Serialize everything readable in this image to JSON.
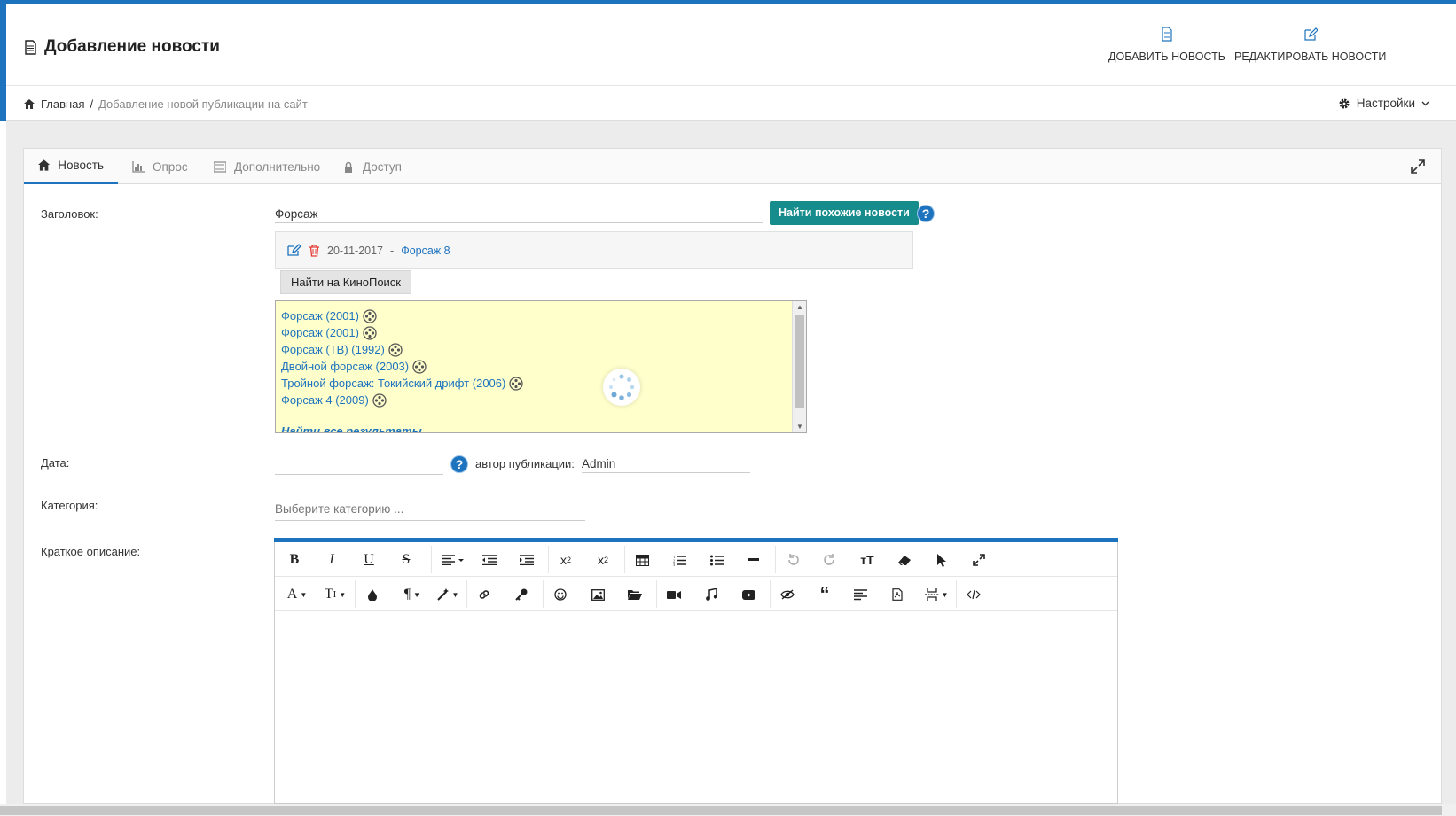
{
  "header": {
    "title": "Добавление новости",
    "actions": [
      {
        "label": "ДОБАВИТЬ НОВОСТЬ",
        "icon": "document-icon"
      },
      {
        "label": "РЕДАКТИРОВАТЬ НОВОСТИ",
        "icon": "edit-icon"
      }
    ]
  },
  "breadcrumb": {
    "home": "Главная",
    "separator": "/",
    "current": "Добавление новой публикации на сайт"
  },
  "settings": {
    "label": "Настройки"
  },
  "tabs": [
    {
      "label": "Новость",
      "icon": "home-icon",
      "active": true
    },
    {
      "label": "Опрос",
      "icon": "bar-chart-icon"
    },
    {
      "label": "Дополнительно",
      "icon": "list-icon"
    },
    {
      "label": "Доступ",
      "icon": "lock-icon"
    }
  ],
  "form": {
    "title_label": "Заголовок:",
    "title_value": "Форсаж",
    "find_similar_label": "Найти похожие новости",
    "similar": {
      "date": "20-11-2017",
      "dash": "-",
      "link": "Форсаж 8"
    },
    "kinopoisk_label": "Найти на КиноПоиск",
    "results": [
      "Форсаж (2001)",
      "Форсаж (2001)",
      "Форсаж (ТВ) (1992)",
      "Двойной форсаж (2003)",
      "Тройной форсаж: Токийский дрифт (2006)",
      "Форсаж 4 (2009)"
    ],
    "results_all": "Найти все результаты",
    "date_label": "Дата:",
    "date_value": "",
    "author_label": "автор публикации:",
    "author_value": "Admin",
    "category_label": "Категория:",
    "category_placeholder": "Выберите категорию ...",
    "short_desc_label": "Краткое описание:"
  },
  "colors": {
    "accent": "#1e73be",
    "teal": "#168c8c",
    "results_bg": "#ffffcc"
  }
}
